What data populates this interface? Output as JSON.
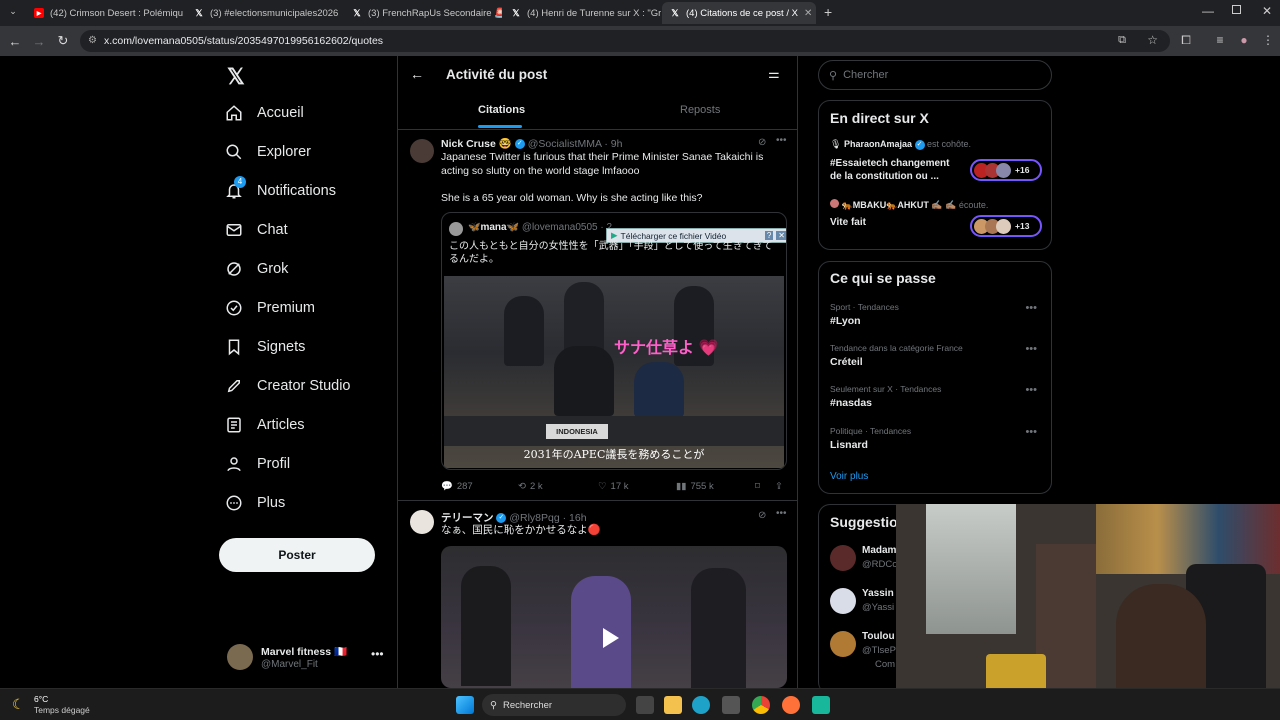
{
  "browser": {
    "tabs": [
      {
        "title": "(42) Crimson Desert : Polémiqu",
        "icon": "youtube-icon"
      },
      {
        "title": "(3) #electionsmunicipales2026",
        "icon": "x-icon"
      },
      {
        "title": "(3) FrenchRapUs Secondaire 🚨",
        "icon": "x-icon"
      },
      {
        "title": "(4) Henri de Turenne sur X : \"Gr",
        "icon": "x-icon"
      },
      {
        "title": "(4) Citations de ce post / X",
        "icon": "x-icon"
      }
    ],
    "url": "x.com/lovemana0505/status/2035497019956162602/quotes"
  },
  "nav": {
    "items": [
      {
        "label": "Accueil",
        "icon": "home-icon"
      },
      {
        "label": "Explorer",
        "icon": "search-icon"
      },
      {
        "label": "Notifications",
        "icon": "bell-icon",
        "badge": "4"
      },
      {
        "label": "Chat",
        "icon": "mail-icon"
      },
      {
        "label": "Grok",
        "icon": "grok-icon"
      },
      {
        "label": "Premium",
        "icon": "premium-icon"
      },
      {
        "label": "Signets",
        "icon": "bookmark-icon"
      },
      {
        "label": "Creator Studio",
        "icon": "rocket-icon"
      },
      {
        "label": "Articles",
        "icon": "article-icon"
      },
      {
        "label": "Profil",
        "icon": "person-icon"
      },
      {
        "label": "Plus",
        "icon": "more-icon"
      }
    ],
    "post_label": "Poster",
    "account": {
      "name": "Marvel fitness 🇫🇷",
      "handle": "@Marvel_Fit"
    }
  },
  "main": {
    "title": "Activité du post",
    "tabs": [
      "Citations",
      "Reposts"
    ],
    "tweets": [
      {
        "name": "Nick Cruse 🤓",
        "handle": "@SocialistMMA",
        "time": "· 9h",
        "text1": "Japanese Twitter is furious that their Prime Minister Sanae Takaichi is acting so slutty on the world stage lmfaooo",
        "text2": "She is a 65 year old woman. Why is she acting like this?",
        "quote": {
          "name": "🦋mana🦋",
          "handle": "@lovemana0505 · 2",
          "text": "この人もともと自分の女性性を「武器」「手段」として使って生きてきてるんだよ。",
          "download_label": "Télécharger ce fichier Vidéo",
          "media_caption": "2031年のAPEC議長を務めることが",
          "media_overlay": "サナ仕草よ 💗",
          "media_nameplate": "INDONESIA"
        },
        "stats": {
          "replies": "287",
          "reposts": "2 k",
          "likes": "17 k",
          "views": "755 k"
        }
      },
      {
        "name": "テリーマン",
        "handle": "@Rly8Pqg",
        "time": "· 16h",
        "text1": "なぁ、国民に恥をかかせるなよ🔴"
      }
    ]
  },
  "right": {
    "search_placeholder": "Chercher",
    "live_title": "En direct sur X",
    "live": [
      {
        "host": "PharaonAmajaa",
        "status": "est cohôte.",
        "title": "#Essaietech changement de la constitution ou ...",
        "count": "+16"
      },
      {
        "host": "🐅MBAKU🐅AHKUT ✍🏽 ✍🏽",
        "status": "écoute.",
        "title": "Vite fait",
        "count": "+13"
      }
    ],
    "happening_title": "Ce qui se passe",
    "trends": [
      {
        "meta": "Sport · Tendances",
        "name": "#Lyon"
      },
      {
        "meta": "Tendance dans la catégorie France",
        "name": "Créteil"
      },
      {
        "meta": "Seulement sur X · Tendances",
        "name": "#nasdas"
      },
      {
        "meta": "Politique · Tendances",
        "name": "Lisnard"
      }
    ],
    "see_more": "Voir plus",
    "suggestions_title": "Suggestio",
    "suggestions": [
      {
        "name": "Madam",
        "handle": "@RDCo"
      },
      {
        "name": "Yassin",
        "handle": "@Yassi"
      },
      {
        "name": "Toulou",
        "handle": "@TlseP",
        "extra": "Com"
      }
    ]
  },
  "taskbar": {
    "weather_temp": "6°C",
    "weather_desc": "Temps dégagé",
    "search_label": "Rechercher"
  }
}
